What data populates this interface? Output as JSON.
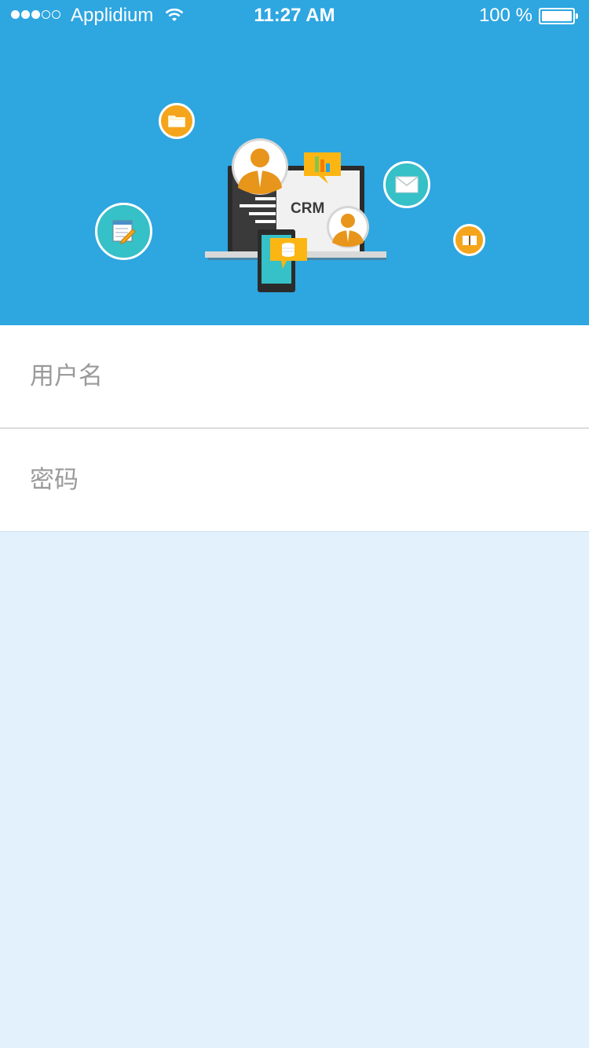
{
  "status_bar": {
    "carrier": "Applidium",
    "time": "11:27 AM",
    "battery_percent": "100 %",
    "battery_level": 1.0,
    "signal_strength": 3,
    "signal_max": 5
  },
  "hero": {
    "device_label": "CRM",
    "icons": [
      "folder-icon",
      "notepad-pencil-icon",
      "mail-icon",
      "book-icon",
      "user-avatar-icon",
      "bar-chart-icon",
      "database-icon"
    ]
  },
  "login_form": {
    "username_placeholder": "用户名",
    "password_placeholder": "密码"
  },
  "colors": {
    "hero_background": "#2ea6e0",
    "page_background": "#e3f1fd",
    "accent_yellow": "#f5a51b",
    "accent_teal": "#36c0c7",
    "avatar_orange": "#e8951b"
  }
}
